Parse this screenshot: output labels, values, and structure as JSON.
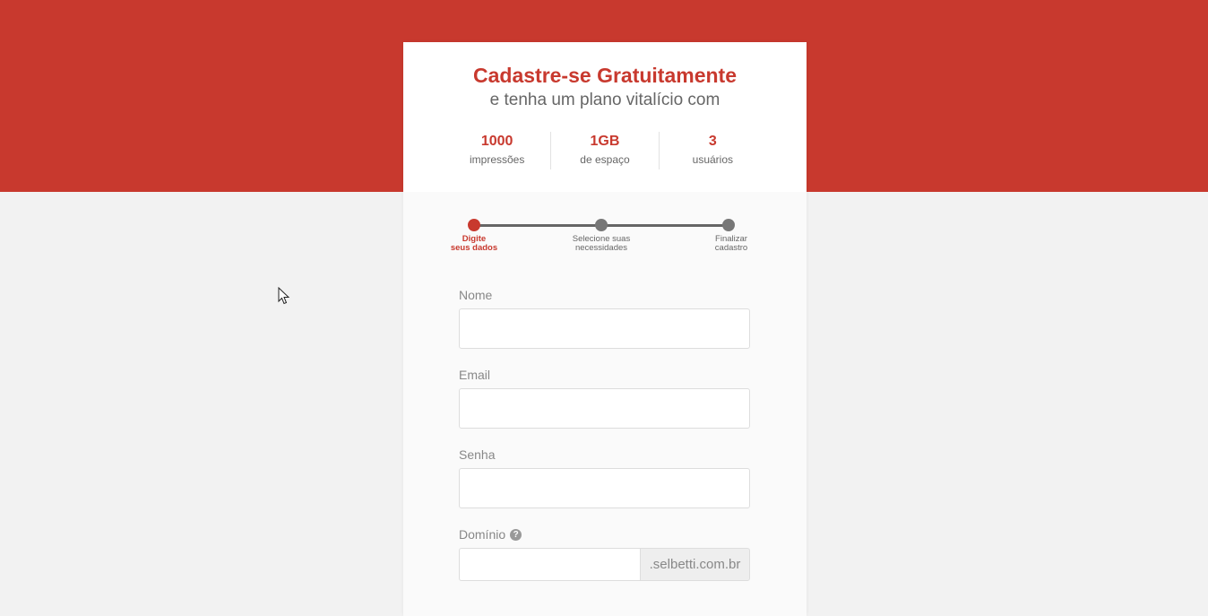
{
  "header": {
    "title": "Cadastre-se Gratuitamente",
    "subtitle": "e tenha um plano vitalício com"
  },
  "stats": [
    {
      "value": "1000",
      "label": "impressões"
    },
    {
      "value": "1GB",
      "label": "de espaço"
    },
    {
      "value": "3",
      "label": "usuários"
    }
  ],
  "steps": [
    {
      "label": "Digite\nseus dados",
      "active": true
    },
    {
      "label": "Selecione suas\nnecessidades",
      "active": false
    },
    {
      "label": "Finalizar\ncadastro",
      "active": false
    }
  ],
  "form": {
    "name_label": "Nome",
    "name_value": "",
    "email_label": "Email",
    "email_value": "",
    "password_label": "Senha",
    "password_value": "",
    "domain_label": "Domínio",
    "domain_value": "",
    "domain_suffix": ".selbetti.com.br",
    "help_glyph": "?"
  },
  "colors": {
    "brand": "#c8392e",
    "muted": "#666666"
  }
}
